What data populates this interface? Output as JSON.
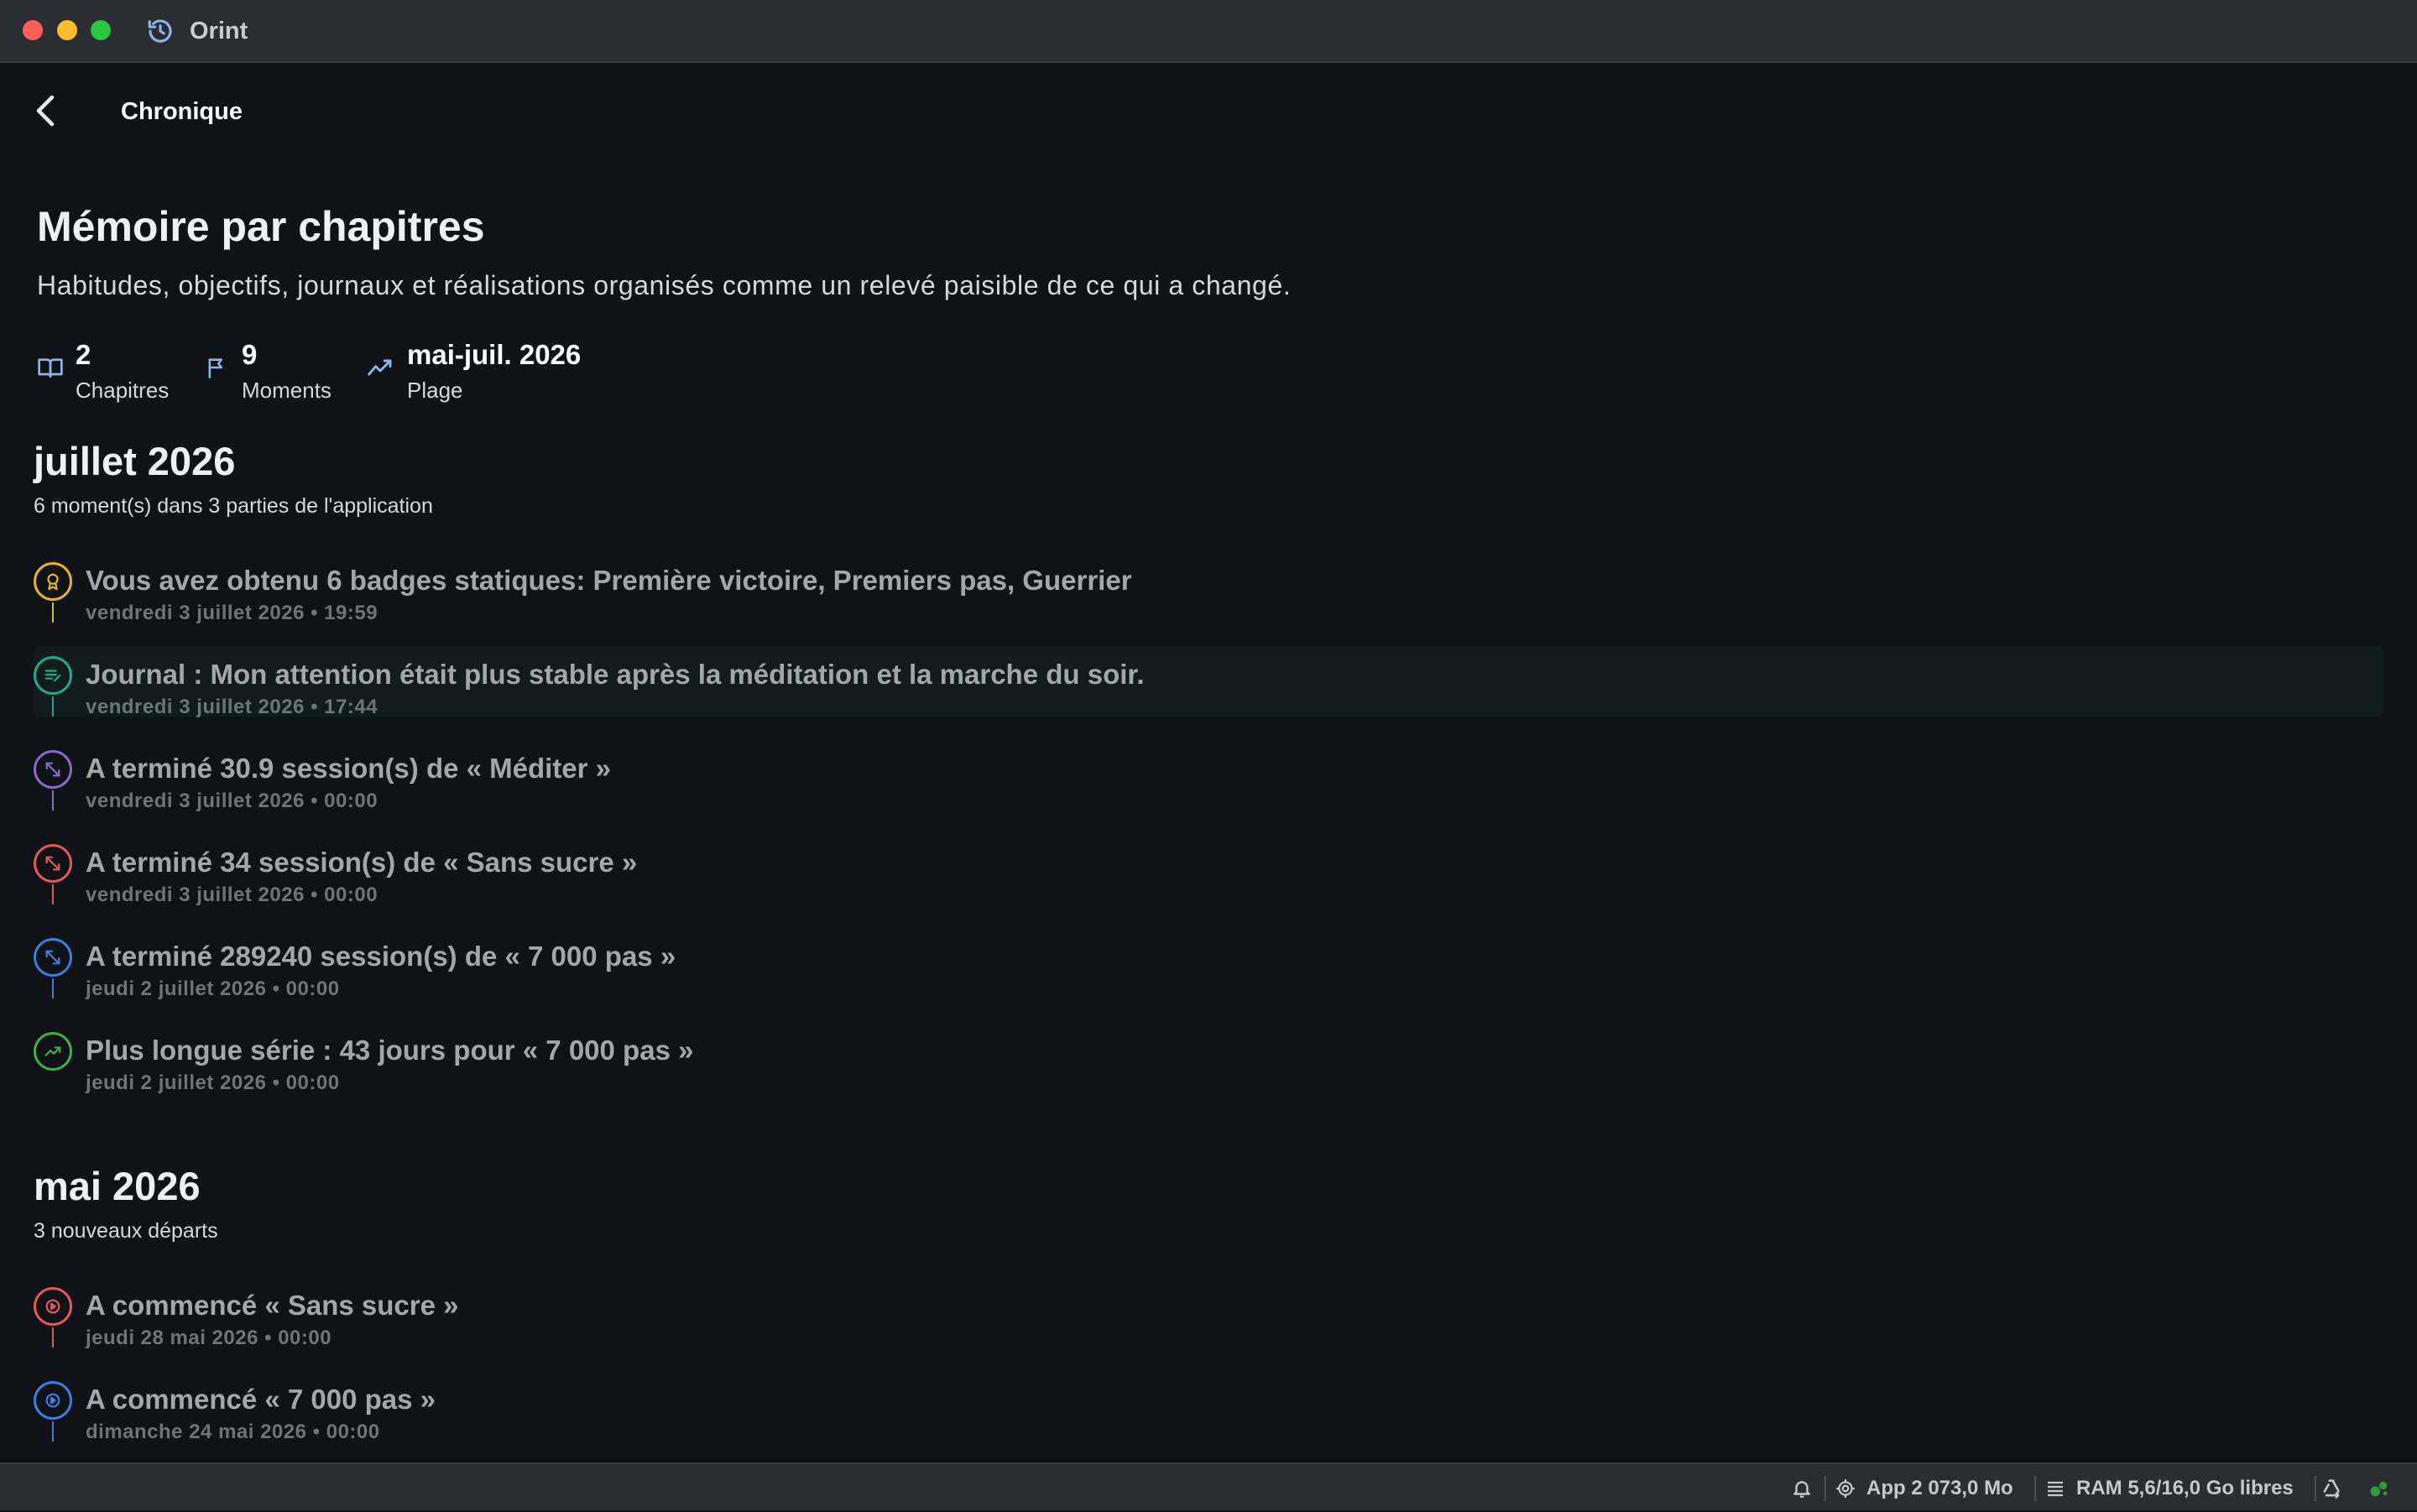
{
  "window": {
    "app_title": "Orint"
  },
  "header": {
    "title": "Chronique"
  },
  "main": {
    "heading": "Mémoire par chapitres",
    "subtitle": "Habitudes, objectifs, journaux et réalisations organisés comme un relevé paisible de ce qui a changé.",
    "stats": [
      {
        "value": "2",
        "label": "Chapitres",
        "icon": "book-icon"
      },
      {
        "value": "9",
        "label": "Moments",
        "icon": "flag-icon"
      },
      {
        "value": "mai-juil. 2026",
        "label": "Plage",
        "icon": "trend-icon"
      }
    ]
  },
  "chapters": [
    {
      "title": "juillet 2026",
      "summary": "6 moment(s) dans 3 parties de l'application",
      "events": [
        {
          "title": "Vous avez obtenu 6 badges statiques: Première victoire, Premiers pas, Guerrier",
          "date": "vendredi 3 juillet 2026 • 19:59",
          "icon": "badge-icon",
          "color": "#e7b321"
        },
        {
          "title": "Journal : Mon attention était plus stable après la méditation et la marche du soir.",
          "date": "vendredi 3 juillet 2026 • 17:44",
          "icon": "journal-icon",
          "color": "#1fa98e"
        },
        {
          "title": "A terminé 30.9 session(s) de « Méditer »",
          "date": "vendredi 3 juillet 2026 • 00:00",
          "icon": "arrows-icon",
          "color": "#8a6bc4"
        },
        {
          "title": "A terminé 34 session(s) de « Sans sucre »",
          "date": "vendredi 3 juillet 2026 • 00:00",
          "icon": "arrows-icon",
          "color": "#e05a5a"
        },
        {
          "title": "A terminé 289240 session(s) de « 7 000 pas »",
          "date": "jeudi 2 juillet 2026 • 00:00",
          "icon": "arrows-icon",
          "color": "#3a7fe0"
        },
        {
          "title": "Plus longue série : 43 jours pour « 7 000 pas »",
          "date": "jeudi 2 juillet 2026 • 00:00",
          "icon": "streak-icon",
          "color": "#3fae48"
        }
      ]
    },
    {
      "title": "mai 2026",
      "summary": "3 nouveaux départs",
      "events": [
        {
          "title": "A commencé « Sans sucre »",
          "date": "jeudi 28 mai 2026 • 00:00",
          "icon": "play-icon",
          "color": "#e05a5a"
        },
        {
          "title": "A commencé « 7 000 pas »",
          "date": "dimanche 24 mai 2026 • 00:00",
          "icon": "play-icon",
          "color": "#3a7fe0"
        }
      ]
    }
  ],
  "statusbar": {
    "app_memory": "App 2 073,0 Mo",
    "ram": "RAM 5,6/16,0 Go libres"
  }
}
